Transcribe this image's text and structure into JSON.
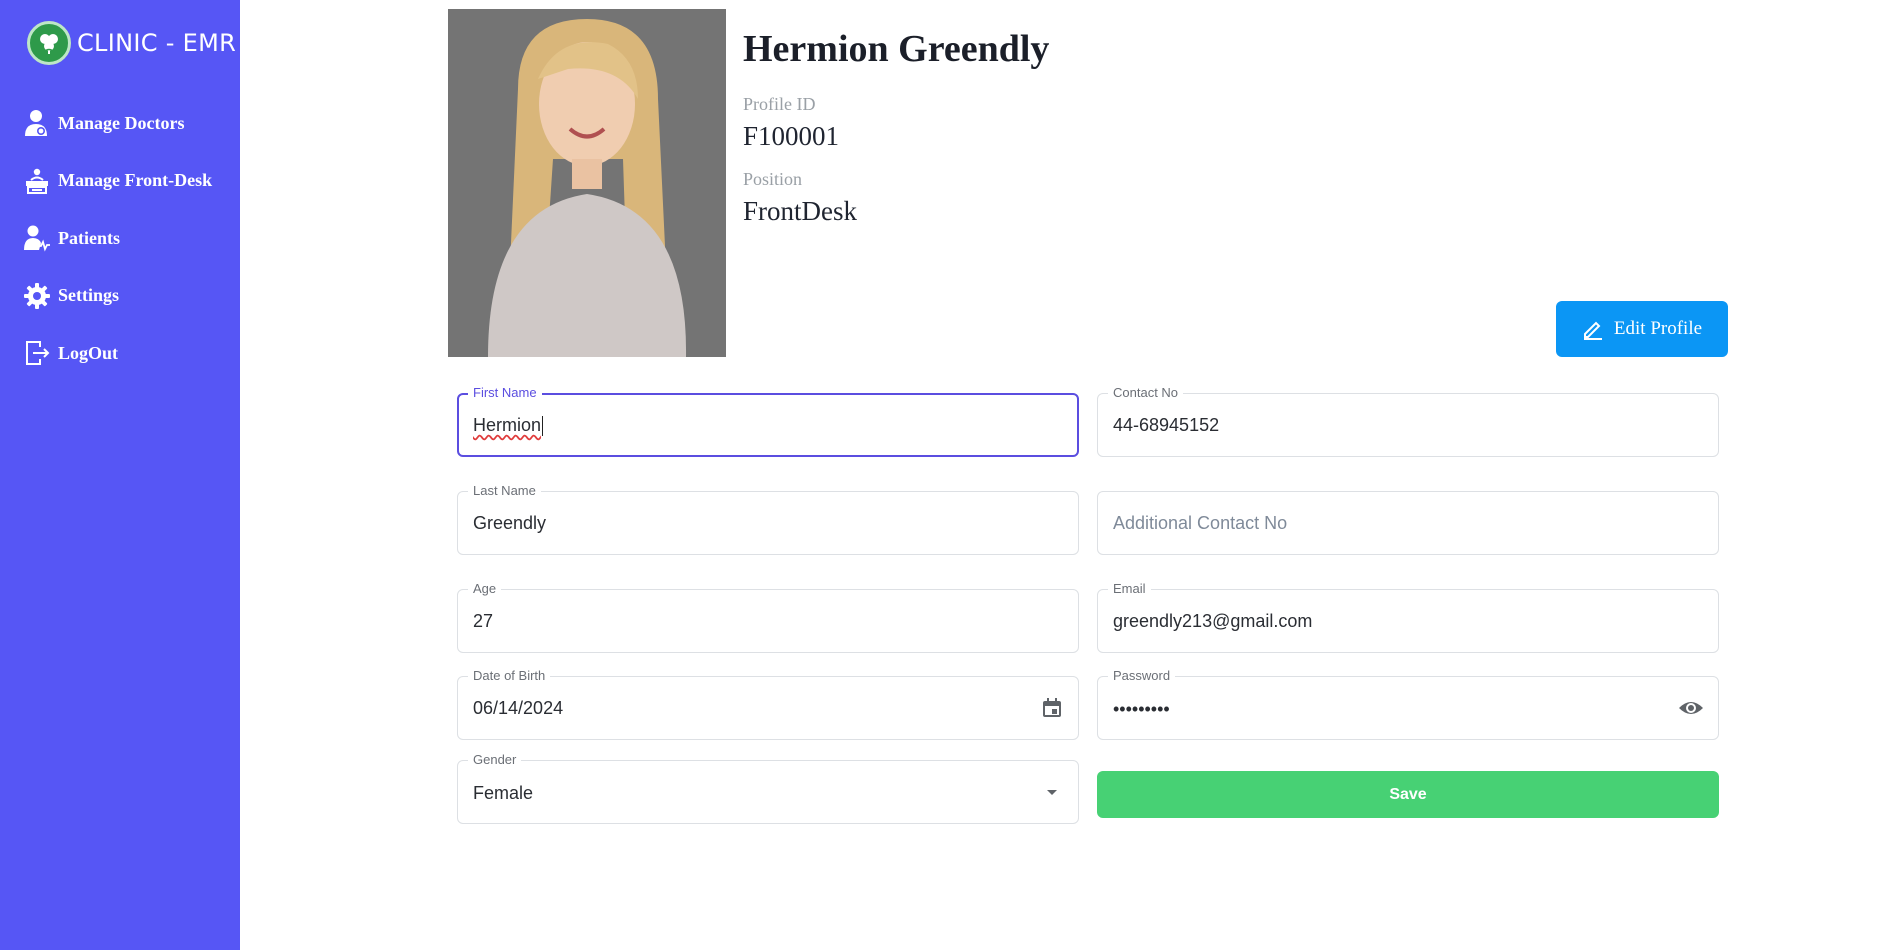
{
  "app": {
    "title": "CLINIC - EMR"
  },
  "sidebar": {
    "items": [
      {
        "label": "Manage Doctors",
        "icon": "doctor-icon"
      },
      {
        "label": "Manage Front-Desk",
        "icon": "front-desk-icon"
      },
      {
        "label": "Patients",
        "icon": "patient-icon"
      },
      {
        "label": "Settings",
        "icon": "gear-icon"
      },
      {
        "label": "LogOut",
        "icon": "logout-icon"
      }
    ]
  },
  "profile": {
    "name": "Hermion Greendly",
    "id_label": "Profile ID",
    "id_value": "F100001",
    "position_label": "Position",
    "position_value": "FrontDesk",
    "edit_label": "Edit Profile"
  },
  "form": {
    "first_name": {
      "label": "First Name",
      "value": "Hermion"
    },
    "contact_no": {
      "label": "Contact No",
      "value": "44-68945152"
    },
    "last_name": {
      "label": "Last Name",
      "value": "Greendly"
    },
    "additional_contact": {
      "placeholder": "Additional Contact No",
      "value": ""
    },
    "age": {
      "label": "Age",
      "value": "27"
    },
    "email": {
      "label": "Email",
      "value": "greendly213@gmail.com"
    },
    "dob": {
      "label": "Date of Birth",
      "value": "06/14/2024"
    },
    "password": {
      "label": "Password",
      "value": "•••••••••"
    },
    "gender": {
      "label": "Gender",
      "value": "Female"
    },
    "save_label": "Save"
  },
  "colors": {
    "sidebar": "#5656f5",
    "edit_button": "#0b96f5",
    "save_button": "#47d174",
    "focus": "#5b4ee0"
  }
}
